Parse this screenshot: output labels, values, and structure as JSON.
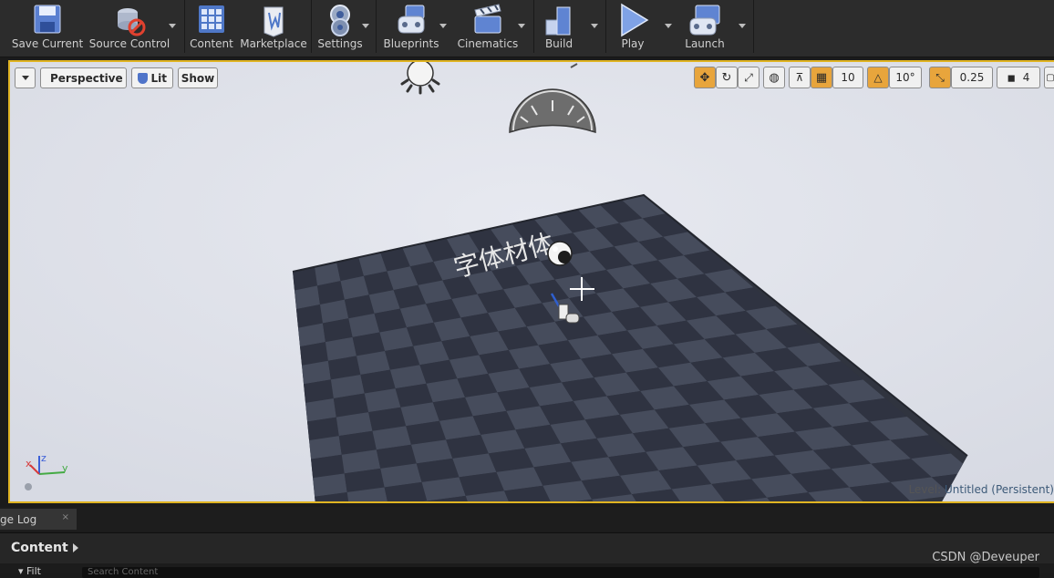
{
  "toolbar": {
    "buttons": [
      {
        "label": "Save Current",
        "icon": "save-icon"
      },
      {
        "label": "Source Control",
        "icon": "source-control-icon"
      },
      {
        "label": "Content",
        "icon": "content-icon"
      },
      {
        "label": "Marketplace",
        "icon": "marketplace-icon"
      },
      {
        "label": "Settings",
        "icon": "settings-icon"
      },
      {
        "label": "Blueprints",
        "icon": "blueprints-icon"
      },
      {
        "label": "Cinematics",
        "icon": "cinematics-icon"
      },
      {
        "label": "Build",
        "icon": "build-icon"
      },
      {
        "label": "Play",
        "icon": "play-icon"
      },
      {
        "label": "Launch",
        "icon": "launch-icon"
      }
    ]
  },
  "viewport": {
    "view_mode": "Perspective",
    "lighting_mode": "Lit",
    "show_label": "Show",
    "grid_snap_value": "10",
    "rotation_snap_value": "10°",
    "scale_snap_value": "0.25",
    "camera_speed_value": "4",
    "scene_text": "字体材体",
    "level_label": "Level:",
    "level_value": "Untitled (Persistent)",
    "axis_labels": {
      "x": "x",
      "y": "y",
      "z": "z"
    }
  },
  "bottom": {
    "log_tab_label": "ge Log",
    "content_title": "Content",
    "filter_label": "Filt",
    "search_placeholder": "Search Content",
    "watermark": "CSDN @Deveuper"
  },
  "colors": {
    "accent": "#e0b422",
    "active_tool": "#e8a53c",
    "viewport_bg": "#dfe2ea",
    "floor_dark": "#2f3341",
    "floor_light": "#464c5c"
  }
}
